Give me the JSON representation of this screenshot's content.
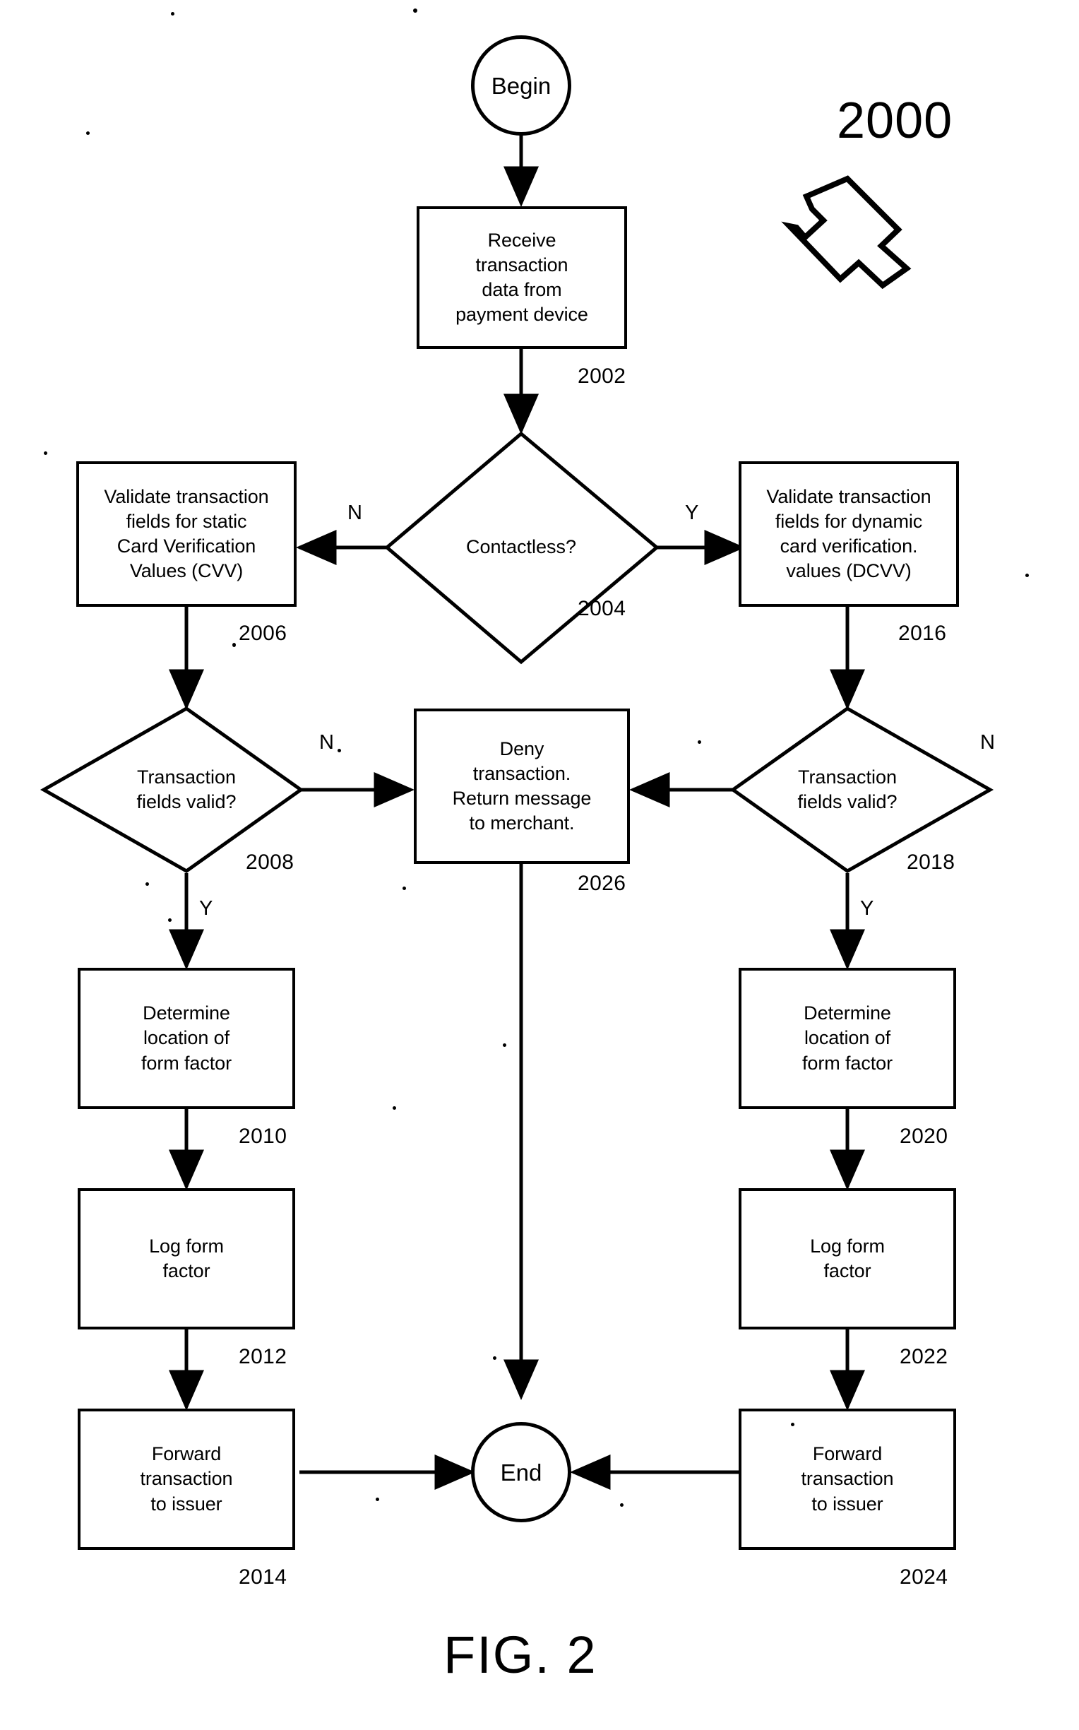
{
  "figure": {
    "caption": "FIG. 2",
    "reference_number": "2000",
    "callout_icon": "hollow-arrow-icon"
  },
  "nodes": {
    "begin": {
      "label": "Begin",
      "shape": "terminal-circle"
    },
    "receive": {
      "label": "Receive\ntransaction\ndata from\npayment device",
      "ref": "2002",
      "shape": "process-box"
    },
    "contactless": {
      "label": "Contactless?",
      "ref": "2004",
      "shape": "decision-diamond"
    },
    "validate_static": {
      "label": "Validate transaction\nfields for static\nCard Verification\nValues (CVV)",
      "ref": "2006",
      "shape": "process-box"
    },
    "fields_valid_left": {
      "label": "Transaction\nfields valid?",
      "ref": "2008",
      "shape": "decision-diamond"
    },
    "determine_left": {
      "label": "Determine\nlocation of\nform factor",
      "ref": "2010",
      "shape": "process-box"
    },
    "log_left": {
      "label": "Log form\nfactor",
      "ref": "2012",
      "shape": "process-box"
    },
    "forward_left": {
      "label": "Forward\ntransaction\nto issuer",
      "ref": "2014",
      "shape": "process-box"
    },
    "validate_dynamic": {
      "label": "Validate transaction\nfields for dynamic\ncard verification.\nvalues (DCVV)",
      "ref": "2016",
      "shape": "process-box"
    },
    "fields_valid_right": {
      "label": "Transaction\nfields valid?",
      "ref": "2018",
      "shape": "decision-diamond"
    },
    "determine_right": {
      "label": "Determine\nlocation of\nform factor",
      "ref": "2020",
      "shape": "process-box"
    },
    "log_right": {
      "label": "Log form\nfactor",
      "ref": "2022",
      "shape": "process-box"
    },
    "forward_right": {
      "label": "Forward\ntransaction\nto issuer",
      "ref": "2024",
      "shape": "process-box"
    },
    "deny": {
      "label": "Deny\ntransaction.\nReturn message\nto merchant.",
      "ref": "2026",
      "shape": "process-box"
    },
    "end": {
      "label": "End",
      "shape": "terminal-circle"
    }
  },
  "branch_labels": {
    "contactless_no": "N",
    "contactless_yes": "Y",
    "left_valid_no": "N",
    "left_valid_yes": "Y",
    "right_valid_no": "N",
    "right_valid_yes": "Y"
  },
  "colors": {
    "ink": "#000000",
    "paper": "#ffffff"
  }
}
